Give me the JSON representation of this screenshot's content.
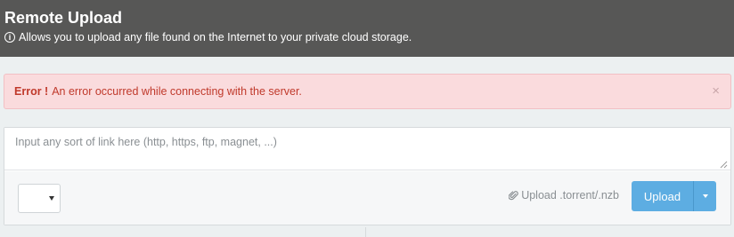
{
  "header": {
    "title": "Remote Upload",
    "subtitle": "Allows you to upload any file found on the Internet to your private cloud storage."
  },
  "alert": {
    "strong": "Error !",
    "message": "An error occurred while connecting with the server.",
    "close": "×"
  },
  "upload_form": {
    "link_placeholder": "Input any sort of link here (http, https, ftp, magnet, ...)",
    "link_value": "",
    "select_value": "",
    "torrent_link": "Upload .torrent/.nzb",
    "upload_button": "Upload"
  },
  "colors": {
    "header_bg": "#575756",
    "alert_bg": "#fadbdd",
    "alert_text": "#c0392b",
    "accent": "#5dade2"
  },
  "icons": {
    "info": "info-circle-icon",
    "paperclip": "paperclip-icon",
    "close": "close-icon"
  }
}
